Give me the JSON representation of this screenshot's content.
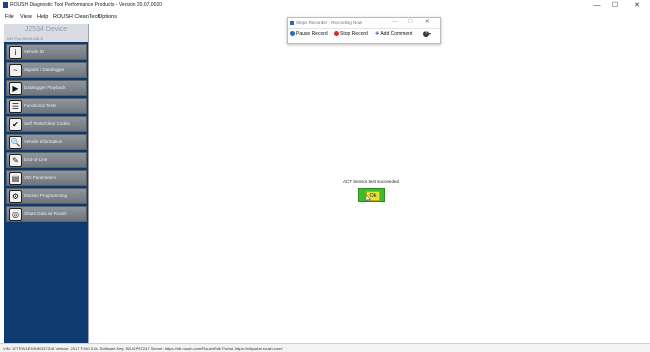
{
  "window": {
    "title": "ROUSH Diagnostic Tool Performance Products - Version 20.07.0020",
    "minimize": "—",
    "maximize": "☐",
    "close": "✕"
  },
  "menu": [
    "File",
    "View",
    "Help",
    "ROUSH CleanTech",
    "Options"
  ],
  "sidebar": {
    "device": "J2534 Device",
    "device_status": "NO Port AVAILABLE",
    "items": [
      {
        "label": "Vehicle ID",
        "icon": "i"
      },
      {
        "label": "Signals / Datalogger",
        "icon": "~"
      },
      {
        "label": "Datalogger Playback",
        "icon": "▶"
      },
      {
        "label": "Functional Tests",
        "icon": "☰"
      },
      {
        "label": "Self Tests/Clear Codes",
        "icon": "✔"
      },
      {
        "label": "Vehicle Information",
        "icon": "🔍"
      },
      {
        "label": "End-of-Line",
        "icon": "✎"
      },
      {
        "label": "VID Parameters",
        "icon": "▤"
      },
      {
        "label": "Module Programming",
        "icon": "⚙"
      },
      {
        "label": "Share Data w/ Roush",
        "icon": "◎"
      }
    ]
  },
  "main": {
    "message": "ACT Sensor test succeeded",
    "ok_label": "Ok"
  },
  "recorder": {
    "title": "Steps Recorder - Recording Now",
    "minimize": "—",
    "maximize": "☐",
    "close": "✕",
    "pause": "Pause Record",
    "stop": "Stop Record",
    "comment": "Add Comment",
    "help": "?",
    "colors": {
      "pause": "#2b6cb0",
      "stop": "#d32f2f"
    }
  },
  "status": "VIN: 1FTEW1E53HKD57318  Vehicle: 2017 F150 5.0L  Software Key: 52UVP97Z47  Server: https://rdt.roush.com/RoushRdt/  Portal: https://rdtportal.roush.com/"
}
